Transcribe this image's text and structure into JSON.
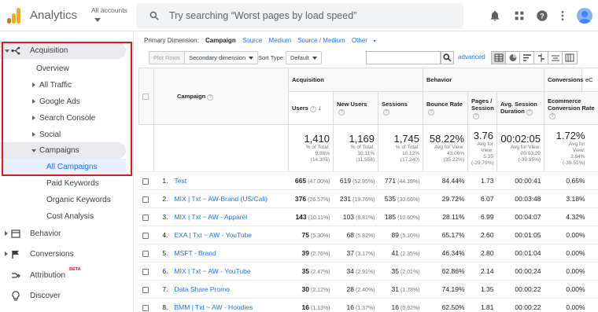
{
  "app": {
    "title": "Analytics",
    "account_label": "All accounts"
  },
  "search": {
    "placeholder": "Try searching “Worst pages by load speed”"
  },
  "sidebar": {
    "acquisition": "Acquisition",
    "overview": "Overview",
    "all_traffic": "All Traffic",
    "google_ads": "Google Ads",
    "search_console": "Search Console",
    "social": "Social",
    "campaigns": "Campaigns",
    "all_campaigns": "All Campaigns",
    "paid_keywords": "Paid Keywords",
    "organic_keywords": "Organic Keywords",
    "cost_analysis": "Cost Analysis",
    "behavior": "Behavior",
    "conversions": "Conversions",
    "attribution": "Attribution",
    "attribution_badge": "BETA",
    "discover": "Discover"
  },
  "dimension_bar": {
    "label": "Primary Dimension:",
    "active": "Campaign",
    "options": [
      "Source",
      "Medium",
      "Source / Medium",
      "Other"
    ]
  },
  "controls": {
    "plot_rows": "Plot Rows",
    "secondary_dimension": "Secondary dimension",
    "sort_type_label": "Sort Type:",
    "sort_type_value": "Default",
    "advanced": "advanced"
  },
  "table": {
    "groups": {
      "acquisition": "Acquisition",
      "behavior": "Behavior",
      "conversions": "Conversions",
      "conv_extra": "eC"
    },
    "headers": {
      "campaign": "Campaign",
      "users": "Users",
      "new_users": "New Users",
      "sessions": "Sessions",
      "bounce_rate": "Bounce Rate",
      "pages_session": "Pages / Session",
      "avg_session_duration": "Avg. Session Duration",
      "ecommerce_rate": "Ecommerce Conversion Rate"
    },
    "totals": {
      "users": {
        "value": "1,410",
        "sub1": "% of Total:",
        "sub2": "9.86%",
        "sub3": "(14,305)"
      },
      "new_users": {
        "value": "1,169",
        "sub1": "% of Total:",
        "sub2": "10.11%",
        "sub3": "(11,558)"
      },
      "sessions": {
        "value": "1,745",
        "sub1": "% of Total:",
        "sub2": "10.12%",
        "sub3": "(17,240)"
      },
      "bounce_rate": {
        "value": "58.22%",
        "sub1": "Avg for View:",
        "sub2": "43.06%",
        "sub3": "(35.22%)"
      },
      "pages_session": {
        "value": "3.76",
        "sub1": "Avg for",
        "sub2": "View:",
        "sub3": "5.35",
        "sub4": "(-29.79%)"
      },
      "avg_duration": {
        "value": "00:02:05",
        "sub1": "Avg for View:",
        "sub2": "00:03:29",
        "sub3": "(-39.95%)"
      },
      "ecommerce": {
        "value": "1.72%",
        "sub1": "Avg for",
        "sub2": "View:",
        "sub3": "2.84%",
        "sub4": "(-39.51%)"
      }
    },
    "rows": [
      {
        "n": "1.",
        "campaign": "Test",
        "users": "665",
        "users_pct": "(47.00%)",
        "new_users": "619",
        "new_pct": "(52.95%)",
        "sessions": "771",
        "sess_pct": "(44.18%)",
        "bounce": "84.44%",
        "pages": "1.73",
        "duration": "00:00:41",
        "ecom": "0.65%"
      },
      {
        "n": "2.",
        "campaign": "MIX | Txt ~ AW-Brand (US/Cali)",
        "users": "376",
        "users_pct": "(26.57%)",
        "new_users": "231",
        "new_pct": "(19.76%)",
        "sessions": "535",
        "sess_pct": "(30.66%)",
        "bounce": "29.72%",
        "pages": "6.07",
        "duration": "00:03:48",
        "ecom": "3.18%"
      },
      {
        "n": "3.",
        "campaign": "MIX | Txt ~ AW - Apparel",
        "users": "143",
        "users_pct": "(10.11%)",
        "new_users": "103",
        "new_pct": "(8.81%)",
        "sessions": "185",
        "sess_pct": "(10.60%)",
        "bounce": "28.11%",
        "pages": "6.99",
        "duration": "00:04:07",
        "ecom": "4.32%"
      },
      {
        "n": "4.",
        "campaign": "EXA | Txt ~ AW - YouTube",
        "users": "75",
        "users_pct": "(5.30%)",
        "new_users": "68",
        "new_pct": "(5.82%)",
        "sessions": "89",
        "sess_pct": "(5.10%)",
        "bounce": "65.17%",
        "pages": "2.60",
        "duration": "00:01:05",
        "ecom": "0.00%"
      },
      {
        "n": "5.",
        "campaign": "MSFT - Brand",
        "users": "39",
        "users_pct": "(2.76%)",
        "new_users": "37",
        "new_pct": "(3.17%)",
        "sessions": "41",
        "sess_pct": "(2.35%)",
        "bounce": "46.34%",
        "pages": "2.80",
        "duration": "00:01:04",
        "ecom": "0.00%"
      },
      {
        "n": "6.",
        "campaign": "MIX | Txt ~ AW - YouTube",
        "users": "35",
        "users_pct": "(2.47%)",
        "new_users": "34",
        "new_pct": "(2.91%)",
        "sessions": "35",
        "sess_pct": "(2.01%)",
        "bounce": "62.86%",
        "pages": "2.14",
        "duration": "00:00:24",
        "ecom": "0.00%"
      },
      {
        "n": "7.",
        "campaign": "Data Share Promo",
        "users": "30",
        "users_pct": "(2.12%)",
        "new_users": "28",
        "new_pct": "(2.40%)",
        "sessions": "31",
        "sess_pct": "(1.78%)",
        "bounce": "74.19%",
        "pages": "1.35",
        "duration": "00:00:22",
        "ecom": "0.00%"
      },
      {
        "n": "8.",
        "campaign": "BMM | Txt ~ AW - Hoodies",
        "users": "16",
        "users_pct": "(1.13%)",
        "new_users": "16",
        "new_pct": "(1.37%)",
        "sessions": "16",
        "sess_pct": "(0.92%)",
        "bounce": "62.50%",
        "pages": "1.81",
        "duration": "00:00:22",
        "ecom": "0.00%"
      }
    ]
  }
}
